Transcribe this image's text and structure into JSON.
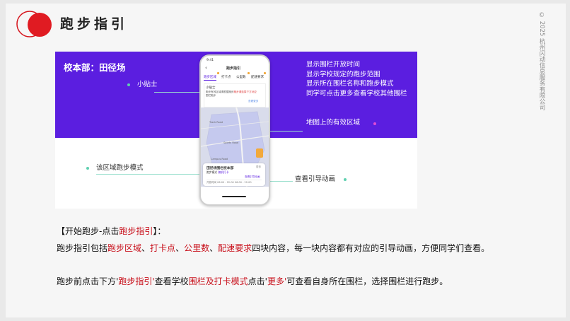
{
  "header": {
    "title": "跑步指引",
    "copyright": "© 2025 杭州闪动信息服务有限公司",
    "logo_colors": {
      "ring": "#d6141c",
      "disc": "#e01b22"
    }
  },
  "panel": {
    "venue": "校本部：田径场",
    "band_color": "#5b1ee0",
    "callouts": {
      "tip": "小贴士",
      "right_top": [
        "显示围栏开放时间",
        "显示学校规定的跑步范围",
        "显示所在围栏名称和跑步模式",
        "同学可点击更多查看学校其他围栏"
      ],
      "map_area": "地图上的有效区域",
      "run_mode": "该区域跑步模式",
      "guide_anim": "查看引导动画"
    },
    "phone": {
      "status_time": "9:41",
      "screen_title": "跑步指引",
      "back_icon": "chevron-left-icon",
      "tabs": [
        "跑步区域",
        "打卡点",
        "公里数",
        "配速要求"
      ],
      "tip_title": "小贴士",
      "tip_text_1": "跑步有效区域请根据跑步",
      "tip_text_highlight": "跑步请选择下方对应",
      "tip_text_2": "围栏跑步",
      "tip_link": "查看更多",
      "map_labels": [
        "Track Road",
        "Sports Road",
        "Campus Road"
      ],
      "card_title": "田径场围栏校本部",
      "card_more": "更多",
      "card_mode_prefix": "跑步模式",
      "card_mode_value": "随机打卡",
      "card_anim_link": "查看引导动画",
      "card_time_label": "开放时间",
      "card_time_value": "06:00 - 22:00  06:00 - 22:00"
    }
  },
  "text": {
    "heading_prefix": "【开始跑步-点击",
    "heading_highlight": "跑步指引",
    "heading_suffix": "】：",
    "line1_prefix": "跑步指引包括",
    "line1_items": [
      "跑步区域",
      "打卡点",
      "公里数",
      "配速要求"
    ],
    "line1_sep": "、",
    "line1_suffix": "四块内容，每一块内容都有对应的引导动画，方便同学们查看。",
    "line2_a": "跑步前点击下方'",
    "line2_b": "跑步指引'",
    "line2_c": "查看学校",
    "line2_d": "围栏及打卡模式",
    "line2_e": "点击'",
    "line2_f": "更多'",
    "line2_g": "可查看自身所在围栏，选择围栏进行跑步。"
  }
}
